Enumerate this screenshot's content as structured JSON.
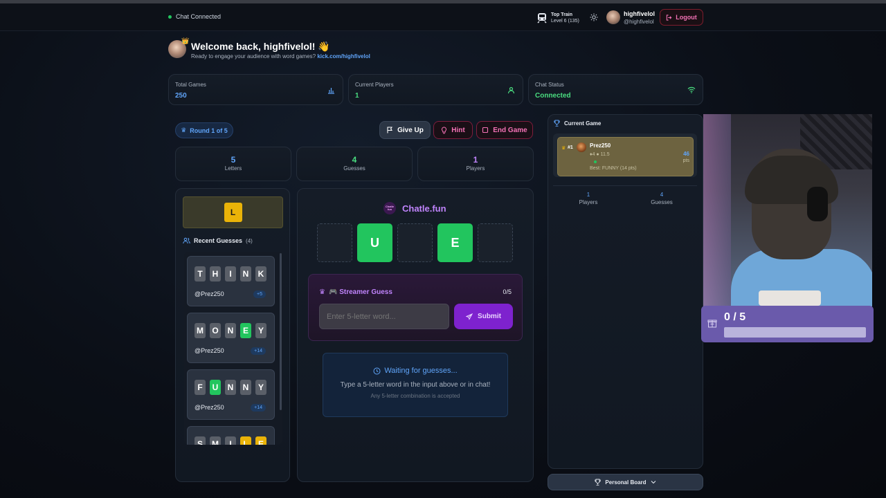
{
  "topbar": {
    "status": "Chat Connected",
    "train_title": "Top Train",
    "train_level": "Level 6  (135)",
    "username": "highfivelol",
    "handle": "@highfivelol",
    "logout": "Logout"
  },
  "welcome": {
    "title": "Welcome back, highfivelol! 👋",
    "subtitle": "Ready to engage your audience with word games?",
    "link": "kick.com/highfivelol"
  },
  "stats": [
    {
      "label": "Total Games",
      "value": "250",
      "color": "#60a5fa"
    },
    {
      "label": "Current Players",
      "value": "1",
      "color": "#4ade80"
    },
    {
      "label": "Chat Status",
      "value": "Connected",
      "color": "#4ade80"
    }
  ],
  "round": "Round 1 of 5",
  "actions": {
    "give_up": "Give Up",
    "hint": "Hint",
    "end_game": "End Game"
  },
  "counters": [
    {
      "value": "5",
      "label": "Letters",
      "color": "#60a5fa"
    },
    {
      "value": "4",
      "label": "Guesses",
      "color": "#4ade80"
    },
    {
      "value": "1",
      "label": "Players",
      "color": "#c084fc"
    }
  ],
  "hint_letter": "L",
  "recent": {
    "title": "Recent Guesses",
    "count": "(4)",
    "items": [
      {
        "letters": [
          "T",
          "H",
          "I",
          "N",
          "K"
        ],
        "states": [
          "g",
          "g",
          "g",
          "g",
          "g"
        ],
        "user": "@Prez250",
        "pts": "+5"
      },
      {
        "letters": [
          "M",
          "O",
          "N",
          "E",
          "Y"
        ],
        "states": [
          "g",
          "g",
          "g",
          "c",
          "g"
        ],
        "user": "@Prez250",
        "pts": "+14"
      },
      {
        "letters": [
          "F",
          "U",
          "N",
          "N",
          "Y"
        ],
        "states": [
          "g",
          "c",
          "g",
          "g",
          "g"
        ],
        "user": "@Prez250",
        "pts": "+14"
      },
      {
        "letters": [
          "S",
          "M",
          "I",
          "L",
          "E"
        ],
        "states": [
          "g",
          "g",
          "g",
          "y",
          "y"
        ],
        "user": "",
        "pts": ""
      }
    ]
  },
  "board": {
    "logo_badge": "Chatle fun",
    "brand": "Chatle.fun",
    "tiles": [
      "",
      "U",
      "",
      "E",
      ""
    ]
  },
  "streamer": {
    "title": "🎮 Streamer Guess",
    "count": "0/5",
    "placeholder": "Enter 5-letter word...",
    "submit": "Submit"
  },
  "waiting": {
    "title": "Waiting for guesses...",
    "line1": "Type a 5-letter word in the input above or in chat!",
    "line2": "Any 5-letter combination is accepted"
  },
  "current_game": {
    "title": "Current Game",
    "rank": "#1",
    "player": "Prez250",
    "meta": "♦4  ● 11.5",
    "best": "Best: FUNNY (14 pts)",
    "points": "46",
    "points_unit": "pts",
    "players_value": "1",
    "players_label": "Players",
    "guesses_value": "4",
    "guesses_label": "Guesses"
  },
  "personal_board": "Personal Board",
  "overlay": {
    "progress": "0 / 5",
    "fill": 0
  },
  "colors": {
    "accent": "#a855f7",
    "green": "#22c55e",
    "yellow": "#eab308",
    "blue": "#60a5fa"
  }
}
